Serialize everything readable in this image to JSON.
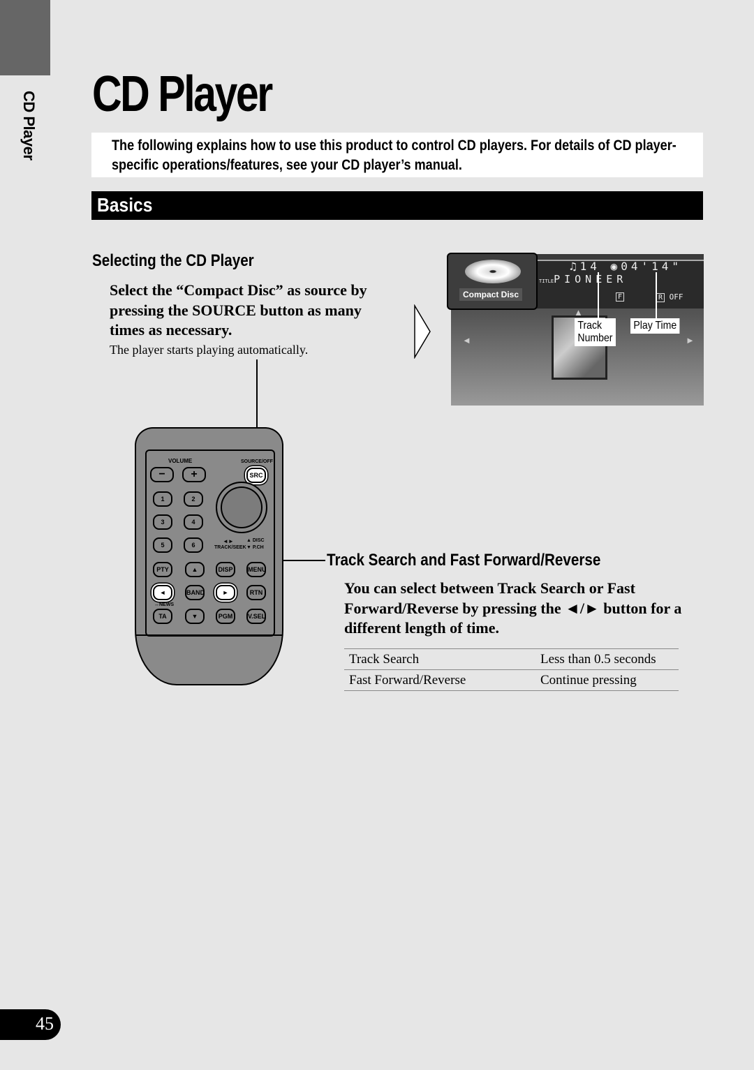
{
  "side_tab": {
    "label": "CD Player"
  },
  "page_title": "CD Player",
  "intro": "The following explains how to use this product to control CD players. For details of CD player-specific operations/features, see your CD player’s manual.",
  "section_title": "Basics",
  "selecting": {
    "heading": "Selecting the CD Player",
    "step_lines": [
      "Select the “Compact Disc” as source by",
      "pressing the SOURCE button as many",
      "times as necessary."
    ],
    "note": "The player starts playing automatically."
  },
  "screen": {
    "source_label": "Compact Disc",
    "track_number": "14",
    "play_time": "04'14\"",
    "title_text": "PIONEER",
    "title_badge": "TITLE",
    "f_badge": "F",
    "r_badge": "R",
    "r_status": "OFF",
    "callouts": {
      "track_number": [
        "Track",
        "Number"
      ],
      "play_time": "Play Time"
    },
    "icons": [
      "note-icon",
      "clock-icon",
      "disc-icon",
      "left-arrow-icon",
      "right-arrow-icon",
      "up-arrow-icon"
    ]
  },
  "remote": {
    "volume_label": "VOLUME",
    "source_label": "SOURCE/OFF",
    "src": "SRC",
    "minus": "−",
    "plus": "+",
    "num": [
      "1",
      "2",
      "3",
      "4",
      "5",
      "6"
    ],
    "track_seek_arrows": "◄►",
    "track_seek": "TRACK/SEEK",
    "disc": "▲ DISC",
    "pch": "▼ P.CH",
    "pty": "PTY",
    "up": "▲",
    "disp": "DISP",
    "menu": "MENU",
    "left": "◄",
    "band": "BAND",
    "right": "►",
    "rtn": "RTN",
    "news": "↔NEWS",
    "ta": "TA",
    "down": "▼",
    "pgm": "PGM",
    "vsel": "V.SEL"
  },
  "track_search": {
    "heading": "Track Search and Fast Forward/Reverse",
    "step_lines": [
      "You can select between Track Search or Fast",
      "Forward/Reverse by pressing the ◄/► button for a",
      "different length of time."
    ],
    "table": [
      {
        "action": "Track Search",
        "duration": "Less than 0.5 seconds"
      },
      {
        "action": "Fast Forward/Reverse",
        "duration": "Continue pressing"
      }
    ]
  },
  "page_number": "45"
}
